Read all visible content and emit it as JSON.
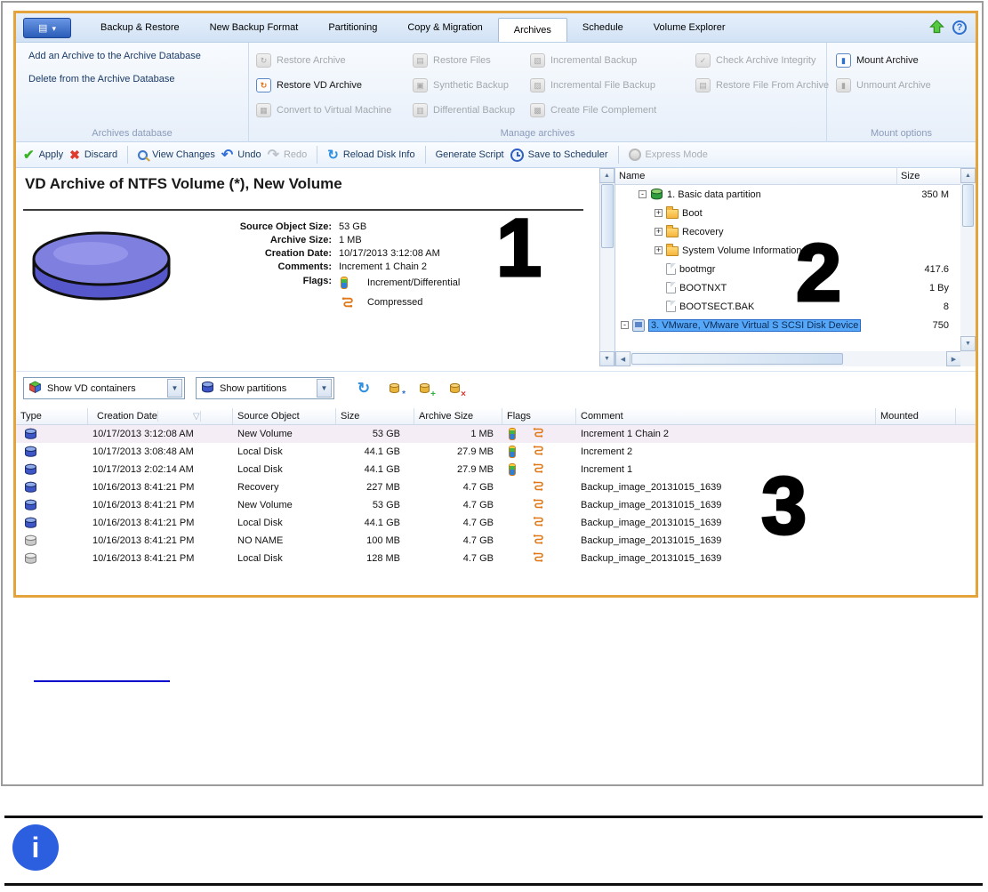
{
  "menubar": {
    "tabs": [
      {
        "label": "Backup & Restore",
        "selected": false
      },
      {
        "label": "New Backup Format",
        "selected": false
      },
      {
        "label": "Partitioning",
        "selected": false
      },
      {
        "label": "Copy & Migration",
        "selected": false
      },
      {
        "label": "Archives",
        "selected": true
      },
      {
        "label": "Schedule",
        "selected": false
      },
      {
        "label": "Volume Explorer",
        "selected": false
      }
    ],
    "help_label": "?"
  },
  "ribbon": {
    "archives_database": {
      "label": "Archives database",
      "items": [
        {
          "label": "Add an Archive to the Archive Database",
          "enabled": true
        },
        {
          "label": "Delete from the Archive Database",
          "enabled": true
        }
      ]
    },
    "manage_archives": {
      "label": "Manage archives",
      "col1": [
        {
          "label": "Restore Archive",
          "enabled": false
        },
        {
          "label": "Restore VD Archive",
          "enabled": true
        },
        {
          "label": "Convert to Virtual Machine",
          "enabled": false
        }
      ],
      "col2": [
        {
          "label": "Restore Files",
          "enabled": false
        },
        {
          "label": "Synthetic Backup",
          "enabled": false
        },
        {
          "label": "Differential Backup",
          "enabled": false
        }
      ],
      "col3": [
        {
          "label": "Incremental Backup",
          "enabled": false
        },
        {
          "label": "Incremental File Backup",
          "enabled": false
        },
        {
          "label": "Create File Complement",
          "enabled": false
        }
      ],
      "col4": [
        {
          "label": "Check Archive Integrity",
          "enabled": false
        },
        {
          "label": "Restore File From Archive",
          "enabled": false
        }
      ]
    },
    "mount_options": {
      "label": "Mount options",
      "items": [
        {
          "label": "Mount Archive",
          "enabled": true
        },
        {
          "label": "Unmount Archive",
          "enabled": false
        }
      ]
    }
  },
  "toolbar": {
    "apply": "Apply",
    "discard": "Discard",
    "view_changes": "View Changes",
    "undo": "Undo",
    "redo": "Redo",
    "reload": "Reload Disk Info",
    "generate_script": "Generate Script",
    "save_to_scheduler": "Save to Scheduler",
    "express_mode": "Express Mode"
  },
  "archive_panel": {
    "title": "VD Archive of NTFS Volume (*), New Volume",
    "fields": [
      {
        "label": "Source Object Size:",
        "value": "53 GB"
      },
      {
        "label": "Archive Size:",
        "value": "1 MB"
      },
      {
        "label": "Creation Date:",
        "value": "10/17/2013 3:12:08 AM"
      },
      {
        "label": "Comments:",
        "value": "Increment 1 Chain 2"
      }
    ],
    "flags_label": "Flags:",
    "flags": [
      {
        "label": "Increment/Differential",
        "icon": "increment-flag"
      },
      {
        "label": "Compressed",
        "icon": "compressed-flag"
      }
    ],
    "annotation": "1"
  },
  "explorer_panel": {
    "columns": {
      "name": "Name",
      "size": "Size"
    },
    "rows": [
      {
        "name": "1. Basic data partition",
        "size": "350 M",
        "expander": "-",
        "icon": "partition",
        "level": 2,
        "selected": false
      },
      {
        "name": "Boot",
        "size": "",
        "expander": "+",
        "icon": "folder",
        "level": 3,
        "selected": false
      },
      {
        "name": "Recovery",
        "size": "",
        "expander": "+",
        "icon": "folder",
        "level": 3,
        "selected": false
      },
      {
        "name": "System Volume Information",
        "size": "",
        "expander": "+",
        "icon": "folder",
        "level": 3,
        "selected": false
      },
      {
        "name": "bootmgr",
        "size": "417.6",
        "expander": "",
        "icon": "file",
        "level": 3,
        "selected": false
      },
      {
        "name": "BOOTNXT",
        "size": "1 By",
        "expander": "",
        "icon": "file",
        "level": 3,
        "selected": false
      },
      {
        "name": "BOOTSECT.BAK",
        "size": "8",
        "expander": "",
        "icon": "file",
        "level": 3,
        "selected": false
      },
      {
        "name": "3. VMware, VMware Virtual S SCSI Disk Device",
        "size": "750",
        "expander": "-",
        "icon": "disk",
        "level": 1,
        "selected": true
      }
    ],
    "annotation": "2"
  },
  "filter_bar": {
    "vd_filter": "Show VD containers",
    "partition_filter": "Show partitions"
  },
  "archive_table": {
    "headers": [
      "Type",
      "Creation Date",
      "Source Object",
      "Size",
      "Archive Size",
      "Flags",
      "Comment",
      "Mounted"
    ],
    "rows": [
      {
        "date": "10/17/2013 3:12:08 AM",
        "source": "New Volume",
        "size": "53 GB",
        "archive_size": "1 MB",
        "increment": true,
        "compressed": true,
        "comment": "Increment 1 Chain 2",
        "mounted": "",
        "type_icon": "vd-container-blue",
        "selected": true
      },
      {
        "date": "10/17/2013 3:08:48 AM",
        "source": "Local Disk",
        "size": "44.1 GB",
        "archive_size": "27.9 MB",
        "increment": true,
        "compressed": true,
        "comment": "Increment 2",
        "mounted": "",
        "type_icon": "vd-container-blue",
        "selected": false
      },
      {
        "date": "10/17/2013 2:02:14 AM",
        "source": "Local Disk",
        "size": "44.1 GB",
        "archive_size": "27.9 MB",
        "increment": true,
        "compressed": true,
        "comment": "Increment 1",
        "mounted": "",
        "type_icon": "vd-container-blue",
        "selected": false
      },
      {
        "date": "10/16/2013 8:41:21 PM",
        "source": "Recovery",
        "size": "227 MB",
        "archive_size": "4.7 GB",
        "increment": false,
        "compressed": true,
        "comment": "Backup_image_20131015_1639",
        "mounted": "",
        "type_icon": "vd-container-blue",
        "selected": false
      },
      {
        "date": "10/16/2013 8:41:21 PM",
        "source": "New Volume",
        "size": "53 GB",
        "archive_size": "4.7 GB",
        "increment": false,
        "compressed": true,
        "comment": "Backup_image_20131015_1639",
        "mounted": "",
        "type_icon": "vd-container-blue",
        "selected": false
      },
      {
        "date": "10/16/2013 8:41:21 PM",
        "source": "Local Disk",
        "size": "44.1 GB",
        "archive_size": "4.7 GB",
        "increment": false,
        "compressed": true,
        "comment": "Backup_image_20131015_1639",
        "mounted": "",
        "type_icon": "vd-container-blue",
        "selected": false
      },
      {
        "date": "10/16/2013 8:41:21 PM",
        "source": "NO NAME",
        "size": "100 MB",
        "archive_size": "4.7 GB",
        "increment": false,
        "compressed": true,
        "comment": "Backup_image_20131015_1639",
        "mounted": "",
        "type_icon": "archive-gray",
        "selected": false
      },
      {
        "date": "10/16/2013 8:41:21 PM",
        "source": "Local Disk",
        "size": "128 MB",
        "archive_size": "4.7 GB",
        "increment": false,
        "compressed": true,
        "comment": "Backup_image_20131015_1639",
        "mounted": "",
        "type_icon": "archive-gray",
        "selected": false
      }
    ],
    "annotation": "3"
  },
  "footer": {
    "info_glyph": "i"
  },
  "colors": {
    "frame_border": "#E4A33B",
    "tree_selection": "#56A7F8",
    "info_icon": "#2C5EE0",
    "flag_orange": "#E07818",
    "link_blue": "#0000CC"
  }
}
